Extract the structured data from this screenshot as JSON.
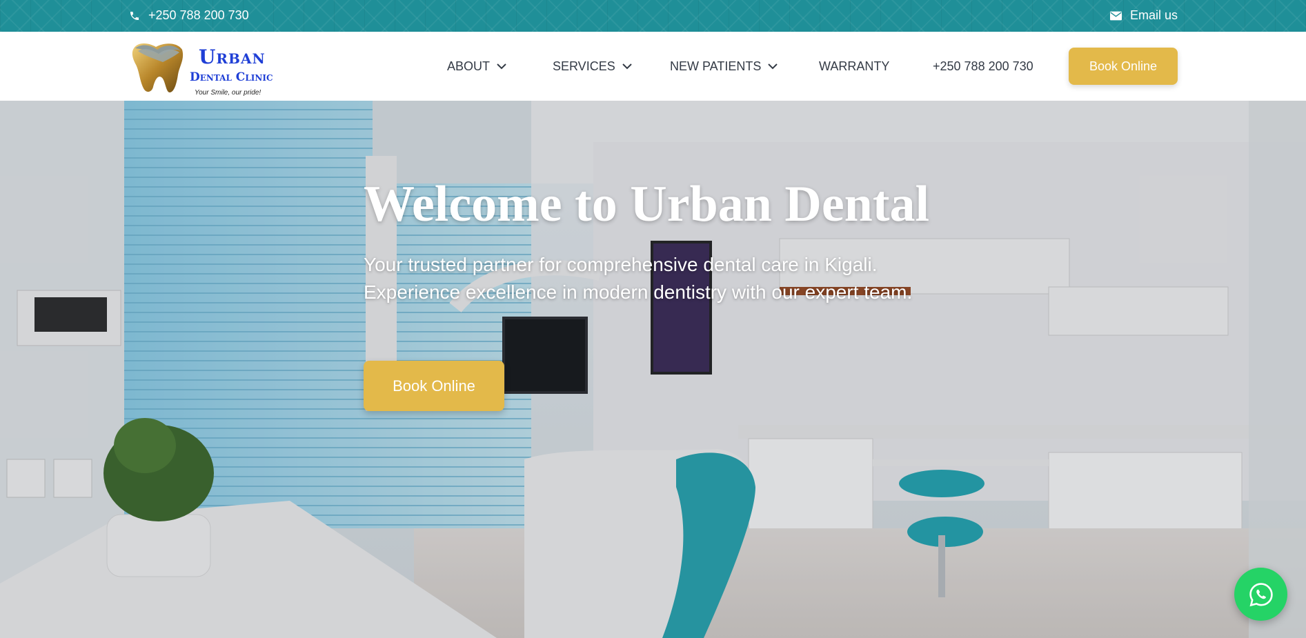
{
  "topbar": {
    "phone": "+250 788 200 730",
    "phone_icon": "phone-icon",
    "email": "Email us",
    "email_icon": "envelope-icon",
    "background_color": "#1f8f98"
  },
  "logo": {
    "line1": "Urban",
    "line2": "Dental Clinic",
    "tagline": "Your Smile, our pride!",
    "brand_color": "#1f3fd6"
  },
  "nav": {
    "about": "ABOUT",
    "services": "SERVICES",
    "new_patients": "NEW PATIENTS",
    "warranty": "WARRANTY",
    "phone": "+250 788 200 730",
    "dropdown_icon": "chevron-down-icon"
  },
  "header_cta": "Book Online",
  "hero": {
    "title": "Welcome to Urban Dental",
    "subtitle": "Your trusted partner for comprehensive dental care in Kigali. Experience excellence in modern dentistry with our expert team.",
    "cta": "Book Online"
  },
  "whatsapp_icon": "whatsapp-icon",
  "colors": {
    "accent": "#e3b94a",
    "whatsapp": "#25d366",
    "nav_text": "#333a45"
  }
}
